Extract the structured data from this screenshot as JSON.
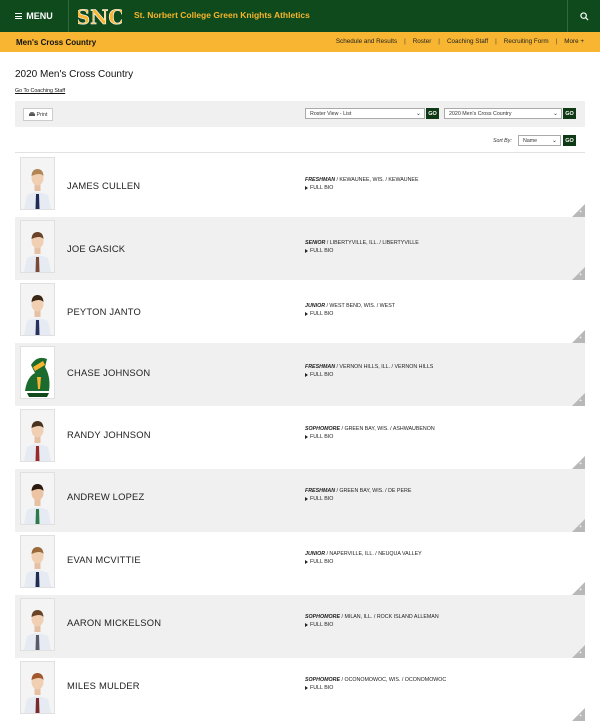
{
  "header": {
    "menu_label": "MENU",
    "logo_text": "SNC",
    "site_title": "St. Norbert College Green Knights Athletics",
    "brand_green": "#0f4a1c",
    "brand_gold": "#f7b531"
  },
  "subnav": {
    "sport_title": "Men's Cross Country",
    "links": [
      "Schedule and Results",
      "Roster",
      "Coaching Staff",
      "Recruiting Form",
      "More +"
    ]
  },
  "page": {
    "heading": "2020 Men's Cross Country",
    "coaching_link": "Go To Coaching Staff"
  },
  "tools": {
    "print_label": "Print",
    "view_select": "Roster View - List",
    "season_select": "2020 Men's Cross Country",
    "go_label": "GO",
    "sort_label": "Sort By:",
    "sort_select": "Name"
  },
  "roster": [
    {
      "name": "JAMES CULLEN",
      "year": "FRESHMAN",
      "details": " / KEWAUNEE, WIS. / KEWAUNEE",
      "bio": "FULL BIO"
    },
    {
      "name": "JOE GASICK",
      "year": "SENIOR",
      "details": " / LIBERTYVILLE, ILL. / LIBERTYVILLE",
      "bio": "FULL BIO"
    },
    {
      "name": "PEYTON JANTO",
      "year": "JUNIOR",
      "details": " / WEST BEND, WIS. / WEST",
      "bio": "FULL BIO"
    },
    {
      "name": "CHASE JOHNSON",
      "year": "FRESHMAN",
      "details": " / VERNON HILLS, ILL. / VERNON HILLS",
      "bio": "FULL BIO"
    },
    {
      "name": "RANDY JOHNSON",
      "year": "SOPHOMORE",
      "details": " / GREEN BAY, WIS. / ASHWAUBENON",
      "bio": "FULL BIO"
    },
    {
      "name": "ANDREW LOPEZ",
      "year": "FRESHMAN",
      "details": " / GREEN BAY, WIS. / DE PERE",
      "bio": "FULL BIO"
    },
    {
      "name": "EVAN MCVITTIE",
      "year": "JUNIOR",
      "details": " / NAPERVILLE, ILL. / NEUQUA VALLEY",
      "bio": "FULL BIO"
    },
    {
      "name": "AARON MICKELSON",
      "year": "SOPHOMORE",
      "details": " / MILAN, ILL. / ROCK ISLAND ALLEMAN",
      "bio": "FULL BIO"
    },
    {
      "name": "MILES MULDER",
      "year": "SOPHOMORE",
      "details": " / OCONOMOWOC, WIS. / OCONOMOWOC",
      "bio": "FULL BIO"
    }
  ]
}
